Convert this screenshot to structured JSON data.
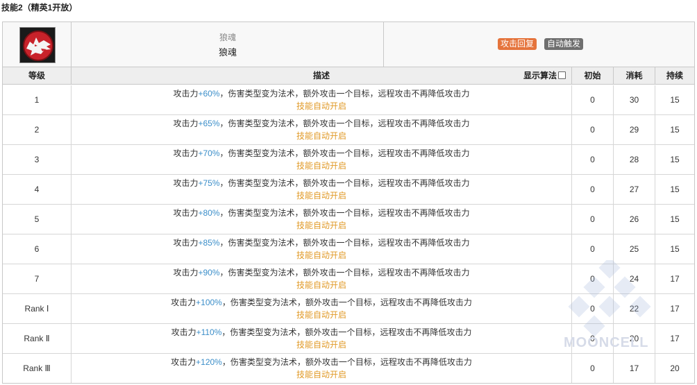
{
  "section_title": "技能2（精英1开放）",
  "skill": {
    "icon": "wolf-soul-icon",
    "name_small": "狼魂",
    "name": "狼魂",
    "tags": [
      {
        "label": "攻击回复",
        "color": "#e5743c"
      },
      {
        "label": "自动触发",
        "color": "#6f6f6f"
      }
    ]
  },
  "table": {
    "headers": {
      "level": "等级",
      "description": "描述",
      "formula_toggle": "显示算法",
      "initial": "初始",
      "cost": "消耗",
      "duration": "持续"
    },
    "rows": [
      {
        "level": "1",
        "pre": "攻击力",
        "value": "+60%",
        "post": "，伤害类型变为法术，额外攻击一个目标，远程攻击不再降低攻击力",
        "auto": "技能自动开启",
        "initial": "0",
        "cost": "30",
        "duration": "15"
      },
      {
        "level": "2",
        "pre": "攻击力",
        "value": "+65%",
        "post": "，伤害类型变为法术，额外攻击一个目标，远程攻击不再降低攻击力",
        "auto": "技能自动开启",
        "initial": "0",
        "cost": "29",
        "duration": "15"
      },
      {
        "level": "3",
        "pre": "攻击力",
        "value": "+70%",
        "post": "，伤害类型变为法术，额外攻击一个目标，远程攻击不再降低攻击力",
        "auto": "技能自动开启",
        "initial": "0",
        "cost": "28",
        "duration": "15"
      },
      {
        "level": "4",
        "pre": "攻击力",
        "value": "+75%",
        "post": "，伤害类型变为法术，额外攻击一个目标，远程攻击不再降低攻击力",
        "auto": "技能自动开启",
        "initial": "0",
        "cost": "27",
        "duration": "15"
      },
      {
        "level": "5",
        "pre": "攻击力",
        "value": "+80%",
        "post": "，伤害类型变为法术，额外攻击一个目标，远程攻击不再降低攻击力",
        "auto": "技能自动开启",
        "initial": "0",
        "cost": "26",
        "duration": "15"
      },
      {
        "level": "6",
        "pre": "攻击力",
        "value": "+85%",
        "post": "，伤害类型变为法术，额外攻击一个目标，远程攻击不再降低攻击力",
        "auto": "技能自动开启",
        "initial": "0",
        "cost": "25",
        "duration": "15"
      },
      {
        "level": "7",
        "pre": "攻击力",
        "value": "+90%",
        "post": "，伤害类型变为法术，额外攻击一个目标，远程攻击不再降低攻击力",
        "auto": "技能自动开启",
        "initial": "0",
        "cost": "24",
        "duration": "17"
      },
      {
        "level": "Rank Ⅰ",
        "pre": "攻击力",
        "value": "+100%",
        "post": "，伤害类型变为法术，额外攻击一个目标，远程攻击不再降低攻击力",
        "auto": "技能自动开启",
        "initial": "0",
        "cost": "22",
        "duration": "17"
      },
      {
        "level": "Rank Ⅱ",
        "pre": "攻击力",
        "value": "+110%",
        "post": "，伤害类型变为法术，额外攻击一个目标，远程攻击不再降低攻击力",
        "auto": "技能自动开启",
        "initial": "0",
        "cost": "20",
        "duration": "17"
      },
      {
        "level": "Rank Ⅲ",
        "pre": "攻击力",
        "value": "+120%",
        "post": "，伤害类型变为法术，额外攻击一个目标，远程攻击不再降低攻击力",
        "auto": "技能自动开启",
        "initial": "0",
        "cost": "17",
        "duration": "20"
      }
    ]
  },
  "colors": {
    "value_highlight": "#3b8ec9",
    "auto_text": "#e19a27"
  },
  "watermark": {
    "text": "MOONCELL",
    "icon": "mooncell-logo-icon"
  }
}
